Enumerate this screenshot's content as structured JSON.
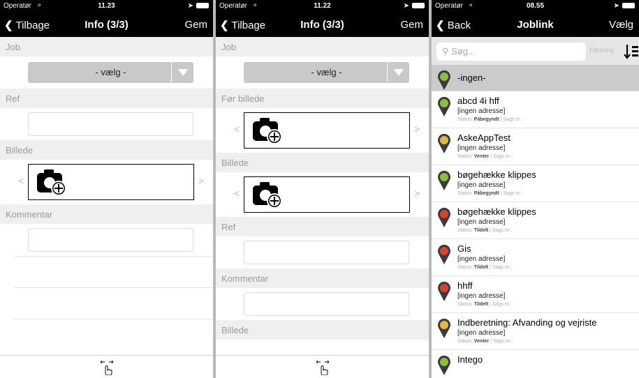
{
  "screens": [
    {
      "status": {
        "operator": "Operatør",
        "time": "11.23"
      },
      "nav": {
        "back": "Tilbage",
        "title": "Info (3/3)",
        "action": "Gem"
      },
      "job_label": "Job",
      "select_value": "- vælg -",
      "ref_label": "Ref",
      "image_label": "Billede",
      "comment_label": "Kommentar"
    },
    {
      "status": {
        "operator": "Operatør",
        "time": "11.22"
      },
      "nav": {
        "back": "Tilbage",
        "title": "Info (3/3)",
        "action": "Gem"
      },
      "job_label": "Job",
      "select_value": "- vælg -",
      "before_image_label": "Før billede",
      "image_label": "Billede",
      "ref_label": "Ref",
      "comment_label": "Kommentar",
      "image_label_2": "Billede"
    },
    {
      "status": {
        "operator": "Operatør",
        "time": "08.55"
      },
      "nav": {
        "back": "Back",
        "title": "Joblink",
        "action": "Vælg"
      },
      "search_placeholder": "Søg...",
      "filter_label": "Filtrering",
      "none_item": "-ingen-",
      "status_prefix": "Status:",
      "case_label": "Sags nr.:",
      "jobs": [
        {
          "name": "abcd 4i hff",
          "address": "[ingen adresse]",
          "status": "Påbegyndt",
          "pin": "#3b3b3b",
          "dot": "#8dbf3c"
        },
        {
          "name": "AskeAppTest",
          "address": "[ingen adresse]",
          "status": "Venter",
          "pin": "#3b3b3b",
          "dot": "#e6b640"
        },
        {
          "name": "bøgehække klippes",
          "address": "[ingen adresse]",
          "status": "Påbegyndt",
          "pin": "#3b3b3b",
          "dot": "#8dbf3c"
        },
        {
          "name": "bøgehække klippes",
          "address": "[ingen adresse]",
          "status": "Tildelt",
          "pin": "#3b3b3b",
          "dot": "#d9412d"
        },
        {
          "name": "Gis",
          "address": "[ingen adresse]",
          "status": "Tildelt",
          "pin": "#3b3b3b",
          "dot": "#d9412d"
        },
        {
          "name": "hhff",
          "address": "[ingen adresse]",
          "status": "Tildelt",
          "pin": "#3b3b3b",
          "dot": "#d9412d"
        },
        {
          "name": "Indberetning: Afvanding og vejriste",
          "address": "[ingen adresse]",
          "status": "Venter",
          "pin": "#3b3b3b",
          "dot": "#e6b640"
        },
        {
          "name": "Intego",
          "address": "",
          "status": "",
          "pin": "#3b3b3b",
          "dot": "#8dbf3c"
        }
      ]
    }
  ]
}
